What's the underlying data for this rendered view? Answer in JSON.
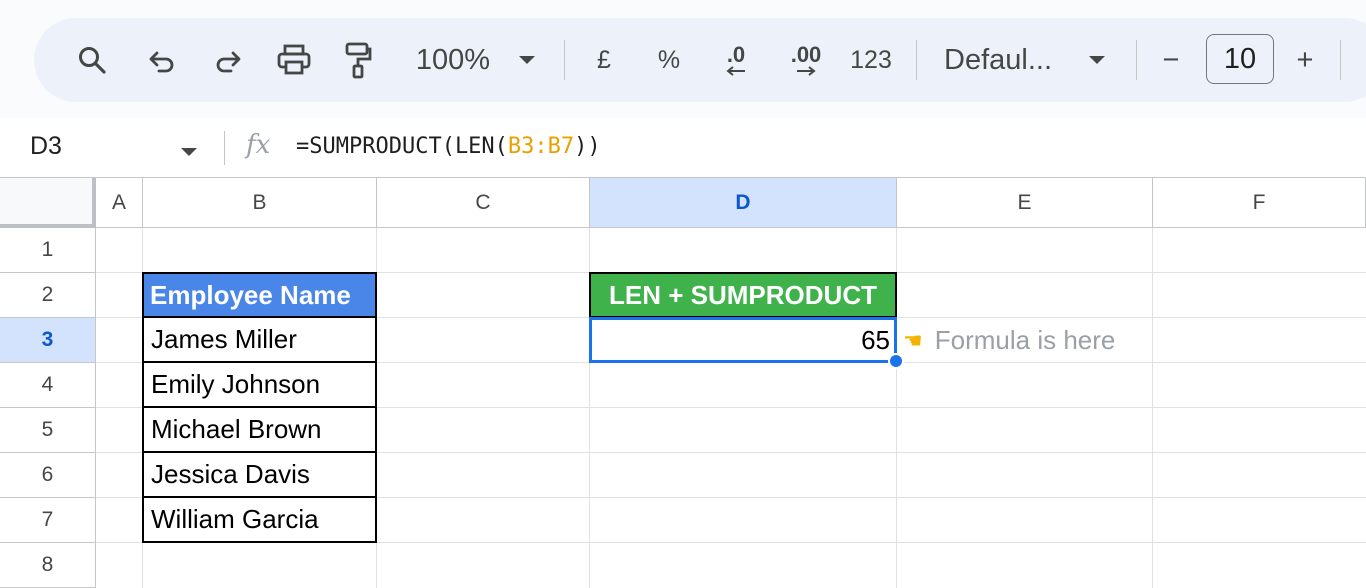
{
  "toolbar": {
    "zoom": "100%",
    "currency_label": "£",
    "percent_label": "%",
    "decrease_decimal_label": ".0",
    "increase_decimal_label": ".00",
    "number_format_label": "123",
    "font_family": "Defaul...",
    "font_size": "10",
    "decrease_label": "−",
    "increase_label": "+"
  },
  "formula_bar": {
    "cell_ref": "D3",
    "fx_label": "fx",
    "formula_prefix": "=SUMPRODUCT(LEN(",
    "formula_ref": "B3:B7",
    "formula_suffix": "))"
  },
  "columns": [
    "A",
    "B",
    "C",
    "D",
    "E",
    "F"
  ],
  "selected_column": "D",
  "rows": [
    "1",
    "2",
    "3",
    "4",
    "5",
    "6",
    "7",
    "8"
  ],
  "selected_row": "3",
  "sheet": {
    "employee_header": "Employee Name",
    "employees": [
      "James Miller",
      "Emily Johnson",
      "Michael Brown",
      "Jessica Davis",
      "William Garcia"
    ],
    "len_header": "LEN + SUMPRODUCT",
    "result": "65",
    "note": "Formula is here"
  },
  "colors": {
    "employee_header_bg": "#4a86e8",
    "len_header_bg": "#3fb24c",
    "selection": "#1a73e8",
    "formula_ref": "#e8a200"
  }
}
